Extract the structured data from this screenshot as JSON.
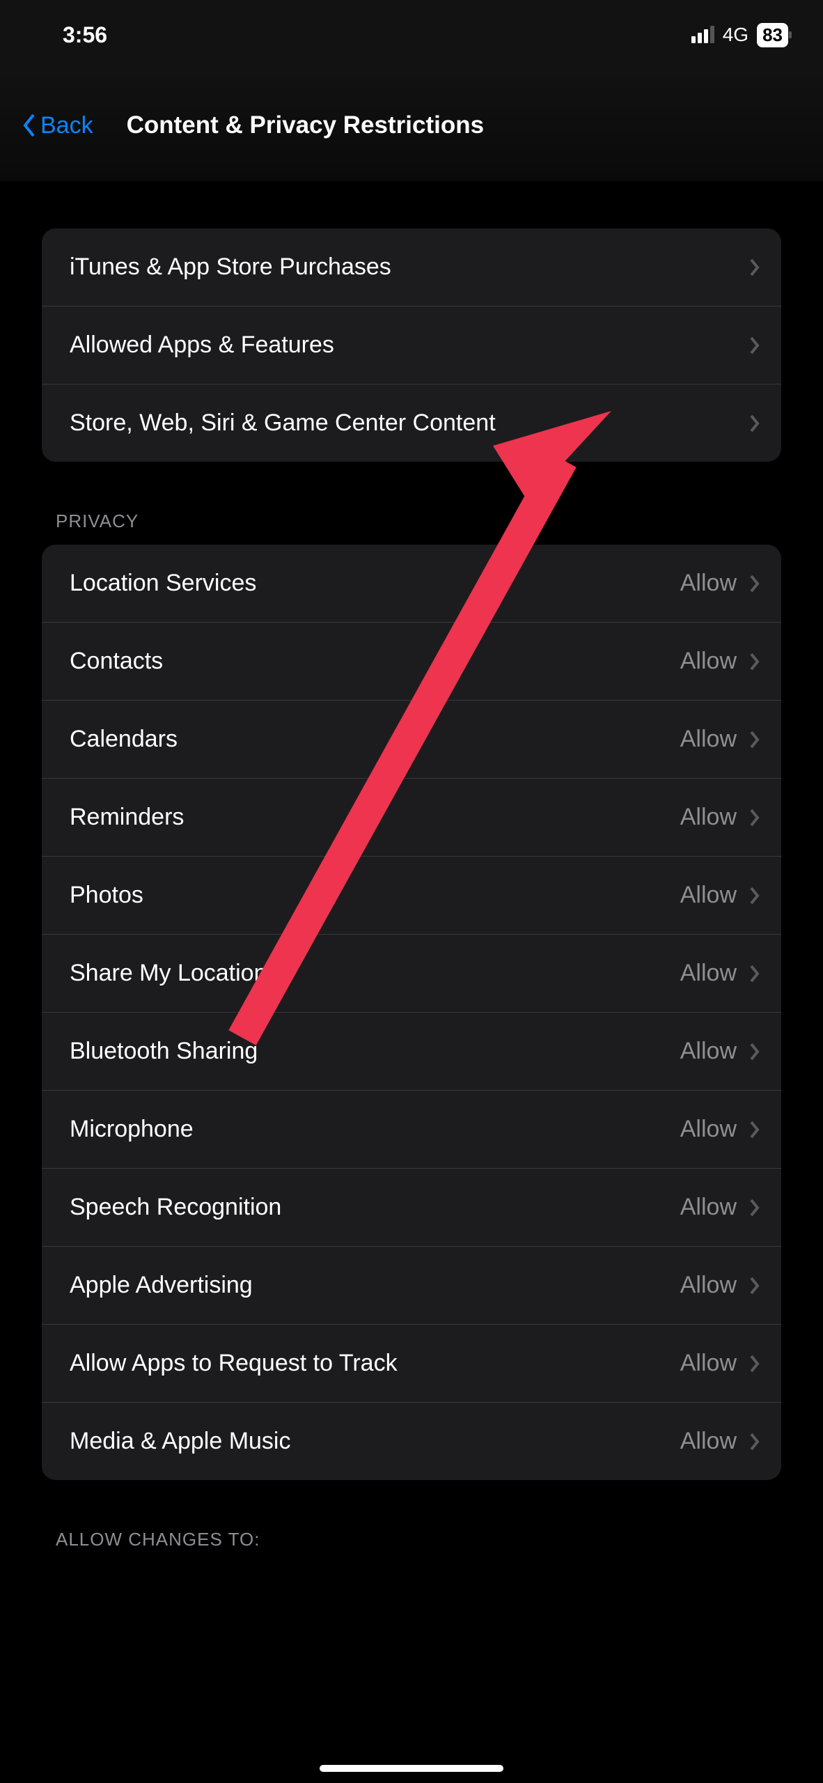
{
  "status": {
    "time": "3:56",
    "network": "4G",
    "battery": "83"
  },
  "nav": {
    "back_label": "Back",
    "title": "Content & Privacy Restrictions"
  },
  "sections": {
    "top": {
      "items": [
        {
          "label": "iTunes & App Store Purchases"
        },
        {
          "label": "Allowed Apps & Features"
        },
        {
          "label": "Store, Web, Siri & Game Center Content"
        }
      ]
    },
    "privacy": {
      "header": "PRIVACY",
      "items": [
        {
          "label": "Location Services",
          "value": "Allow"
        },
        {
          "label": "Contacts",
          "value": "Allow"
        },
        {
          "label": "Calendars",
          "value": "Allow"
        },
        {
          "label": "Reminders",
          "value": "Allow"
        },
        {
          "label": "Photos",
          "value": "Allow"
        },
        {
          "label": "Share My Location",
          "value": "Allow"
        },
        {
          "label": "Bluetooth Sharing",
          "value": "Allow"
        },
        {
          "label": "Microphone",
          "value": "Allow"
        },
        {
          "label": "Speech Recognition",
          "value": "Allow"
        },
        {
          "label": "Apple Advertising",
          "value": "Allow"
        },
        {
          "label": "Allow Apps to Request to Track",
          "value": "Allow"
        },
        {
          "label": "Media & Apple Music",
          "value": "Allow"
        }
      ]
    },
    "allow_changes": {
      "header": "ALLOW CHANGES TO:"
    }
  }
}
